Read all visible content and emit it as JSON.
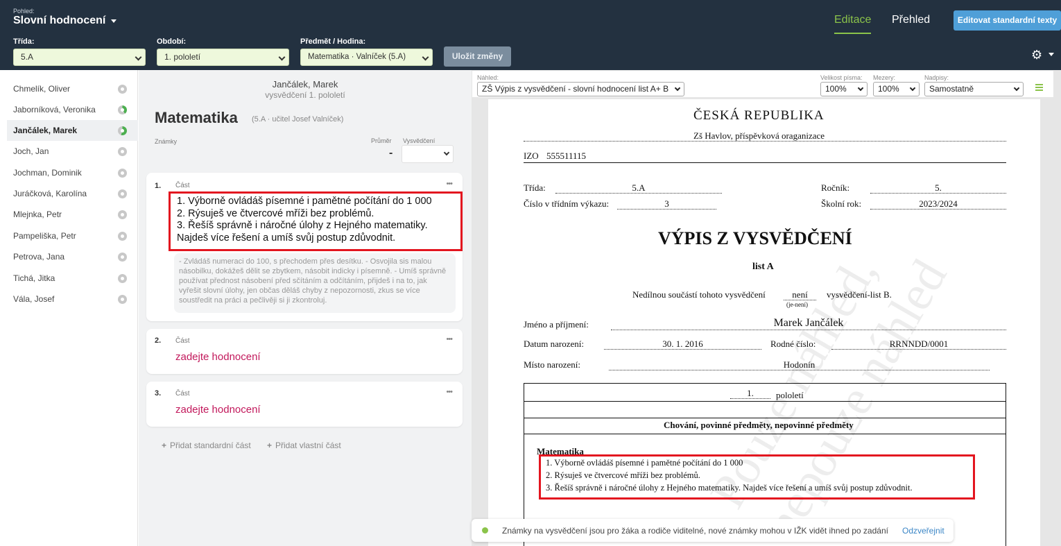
{
  "header": {
    "view_small": "Pohled:",
    "view_title": "Slovní hodnocení",
    "class_label": "Třída:",
    "class_value": "5.A",
    "period_label": "Období:",
    "period_value": "1. pololetí",
    "subject_label": "Předmět / Hodina:",
    "subject_value": "Matematika · Valníček (5.A)",
    "save_button": "Uložit změny",
    "tab_edit": "Editace",
    "tab_overview": "Přehled",
    "edit_std_button": "Editovat standardní texty",
    "accent": "#8bc34a"
  },
  "students": [
    {
      "name": "Chmelík, Oliver",
      "status": "empty"
    },
    {
      "name": "Jaborníková, Veronika",
      "status": "partial"
    },
    {
      "name": "Jančálek, Marek",
      "status": "partial",
      "active": true
    },
    {
      "name": "Joch, Jan",
      "status": "empty"
    },
    {
      "name": "Jochman, Dominik",
      "status": "empty"
    },
    {
      "name": "Juráčková, Karolína",
      "status": "empty"
    },
    {
      "name": "Mlejnka, Petr",
      "status": "empty"
    },
    {
      "name": "Pampeliška, Petr",
      "status": "empty"
    },
    {
      "name": "Petrova, Jana",
      "status": "empty"
    },
    {
      "name": "Tichá, Jitka",
      "status": "empty"
    },
    {
      "name": "Vála, Josef",
      "status": "empty"
    }
  ],
  "editor": {
    "student_name": "Jančálek, Marek",
    "subtitle": "vysvědčení 1. pololetí",
    "subject": "Matematika",
    "subject_meta": "(5.A · učitel Josef Valníček)",
    "grades_label": "Známky",
    "average_label": "Průměr",
    "report_label": "Vysvědčení",
    "average_value": "-",
    "parts": [
      {
        "num": "1.",
        "label": "Část",
        "text": "1. Výborně ovládáš písemné i pamětné počítání do 1 000\n2. Rýsuješ ve čtvercové mříži bez problémů.\n3. Řešíš správně i náročné úlohy z Hejného matematiky.\nNajdeš více řešení a umíš svůj postup zdůvodnit.",
        "hint": "- Zvládáš numeraci do 100, s přechodem přes desítku. - Osvojila sis malou násobilku, dokážeš dělit se zbytkem, násobit indicky i písemně. - Umíš správně používat přednost násobení před sčítáním a odčítáním, přijdeš i na to, jak vyřešit slovní úlohy, jen občas děláš chyby z nepozornosti, zkus se více soustředit na práci a pečlivěji si ji zkontroluj."
      },
      {
        "num": "2.",
        "label": "Část",
        "placeholder": "zadejte hodnocení"
      },
      {
        "num": "3.",
        "label": "Část",
        "placeholder": "zadejte hodnocení"
      }
    ],
    "add_standard": "Přidat standardní část",
    "add_custom": "Přidat vlastní část"
  },
  "preview": {
    "preview_label": "Náhled:",
    "preview_value": "ZŠ Výpis z vysvědčení - slovní hodnocení list A+ B",
    "font_size_label": "Velikost písma:",
    "font_size_value": "100%",
    "spacing_label": "Mezery:",
    "spacing_value": "100%",
    "headings_label": "Nadpisy:",
    "headings_value": "Samostatně"
  },
  "document": {
    "country": "ČESKÁ REPUBLIKA",
    "school": "Zš Havlov, příspěvková oraganizace",
    "izo_label": "IZO",
    "izo_value": "555511115",
    "class_label": "Třída:",
    "class_value": "5.A",
    "grade_label": "Ročník:",
    "grade_value": "5.",
    "register_label": "Číslo v třídním výkazu:",
    "register_value": "3",
    "year_label": "Školní rok:",
    "year_value": "2023/2024",
    "title": "VÝPIS Z VYSVĚDČENÍ",
    "list": "list A",
    "part_prefix": "Nedílnou součástí tohoto vysvědčení",
    "part_value": "není",
    "part_hint": "(je-není)",
    "part_suffix": "vysvědčení-list B.",
    "name_label": "Jméno a příjmení:",
    "name_value": "Marek Jančálek",
    "birth_label": "Datum narození:",
    "birth_value": "30. 1. 2016",
    "id_label": "Rodné číslo:",
    "id_value": "RRNNDD/0001",
    "place_label": "Místo narození:",
    "place_value": "Hodonín",
    "period_value": "1.",
    "period_label": "pololetí",
    "section_header": "Chování, povinné předměty, nepovinné předměty",
    "subject": "Matematika",
    "lines": [
      "1. Výborně ovládáš písemné i pamětné počítání do 1 000",
      "2. Rýsuješ ve čtvercové mříži bez problémů.",
      "3. Řešíš správně i náročné úlohy z Hejného matematiky. Najdeš více řešení a umíš svůj postup zdůvodnit."
    ],
    "watermark_line1": "Pouze náhled,",
    "watermark_line2": "nepouze náhled"
  },
  "notice": {
    "text": "Známky na vysvědčení jsou pro žáka a rodiče viditelné, nové známky mohou v IŽK vidět ihned po zadání",
    "link": "Odzveřejnit"
  }
}
